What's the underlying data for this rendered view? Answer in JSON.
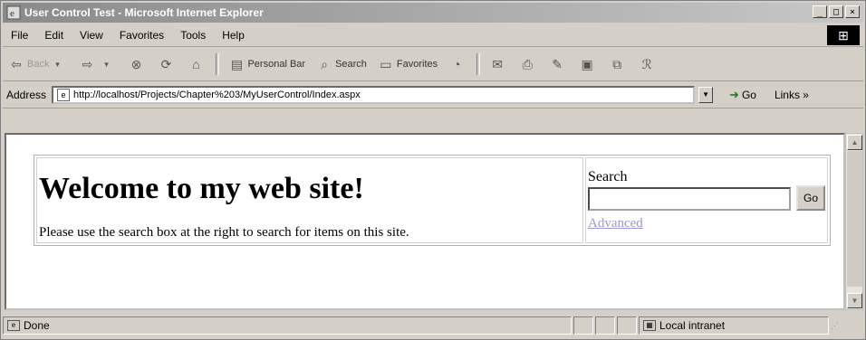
{
  "window": {
    "title": "User Control Test - Microsoft Internet Explorer",
    "buttons": [
      "_",
      "□",
      "×"
    ]
  },
  "menubar": {
    "items": [
      "File",
      "Edit",
      "View",
      "Favorites",
      "Tools",
      "Help"
    ]
  },
  "toolbar": {
    "back": "Back",
    "forward": "",
    "personal_bar": "Personal Bar",
    "search": "Search",
    "favorites": "Favorites"
  },
  "addressbar": {
    "label": "Address",
    "url": "http://localhost/Projects/Chapter%203/MyUserControl/Index.aspx",
    "go": "Go",
    "links": "Links »"
  },
  "page": {
    "heading": "Welcome to my web site!",
    "intro": "Please use the search box at the right to search for items on this site.",
    "search_label": "Search",
    "search_value": "",
    "go_button": "Go",
    "advanced_link": "Advanced"
  },
  "statusbar": {
    "status": "Done",
    "zone": "Local intranet"
  },
  "colors": {
    "chrome": "#d4d0c8",
    "link_visited": "#9a9ad0"
  }
}
